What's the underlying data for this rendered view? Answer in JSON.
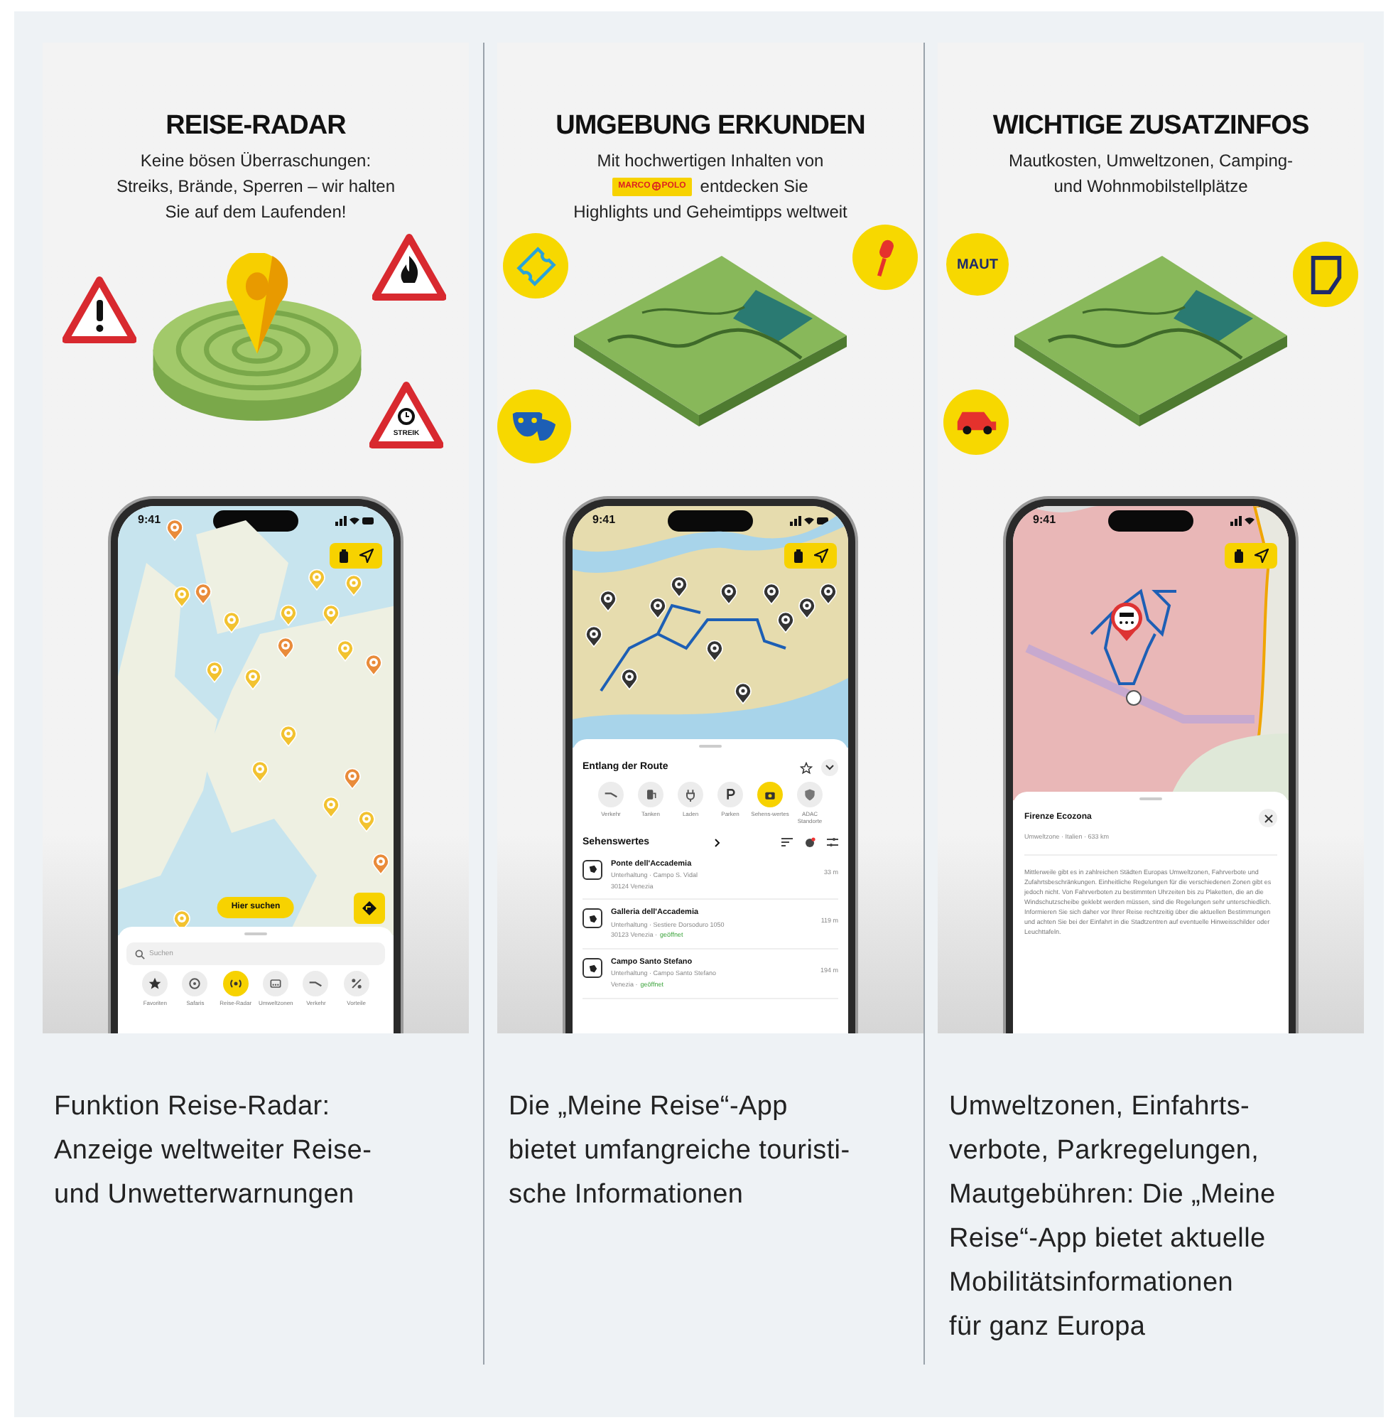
{
  "panels": [
    {
      "kind": "radar",
      "title": "REISE-RADAR",
      "subtitle": [
        "Keine bösen Überraschungen:",
        "Streiks, Brände, Sperren – wir halten",
        "Sie auf dem Laufenden!"
      ],
      "badges": [
        {
          "kind": "exclamation-sign"
        },
        {
          "kind": "fire-sign"
        },
        {
          "kind": "strike-sign",
          "label": "STREIK"
        }
      ],
      "phone": {
        "kind": "map-search",
        "time": "9:41",
        "search_button": "Hier suchen",
        "search": {
          "placeholder": "Suchen"
        },
        "categories": [
          {
            "label": "Favoriten",
            "selected": false
          },
          {
            "label": "Safaris",
            "selected": false
          },
          {
            "label": "Reise-Radar",
            "selected": true
          },
          {
            "label": "Umweltzonen",
            "selected": false
          },
          {
            "label": "Verkehr",
            "selected": false
          },
          {
            "label": "Vorteile",
            "selected": false
          }
        ]
      },
      "caption": [
        "Funktion Reise-Radar:",
        "Anzeige weltweiter Reise-",
        "und Unwetterwarnungen"
      ]
    },
    {
      "kind": "explore",
      "title": "UMGEBUNG ERKUNDEN",
      "subtitle": [
        "Mit hochwertigen Inhalten von"
      ],
      "logo": {
        "left": "MARCO",
        "right": "POLO"
      },
      "subtitle_after": [
        "entdecken Sie",
        "Highlights und Geheimtipps weltweit"
      ],
      "badges": [
        {
          "kind": "ticket"
        },
        {
          "kind": "microphone"
        },
        {
          "kind": "masks"
        }
      ],
      "phone": {
        "kind": "route-list",
        "time": "9:41",
        "header": "Entlang der Route",
        "categories": [
          {
            "label": "Verkehr",
            "selected": false
          },
          {
            "label": "Tanken",
            "selected": false
          },
          {
            "label": "Laden",
            "selected": false
          },
          {
            "label": "Parken",
            "selected": false
          },
          {
            "label": "Sehens-wertes",
            "selected": true
          },
          {
            "label": "ADAC Standorte",
            "selected": false
          }
        ],
        "section": "Sehenswertes",
        "items": [
          {
            "name": "Ponte dell'Accademia",
            "line1": "Unterhaltung · Campo S. Vidal",
            "line2": "30124 Venezia",
            "distance": "33 m"
          },
          {
            "name": "Galleria dell'Accademia",
            "line1": "Unterhaltung · Sestiere Dorsoduro 1050",
            "line2": "30123 Venezia ·",
            "status": "geöffnet",
            "distance": "119 m"
          },
          {
            "name": "Campo Santo Stefano",
            "line1": "Unterhaltung · Campo Santo Stefano",
            "line2": "Venezia ·",
            "status": "geöffnet",
            "distance": "194 m"
          }
        ]
      },
      "caption": [
        "Die „Meine Reise“-App",
        "bietet umfangreiche touristi-",
        "sche Informationen"
      ]
    },
    {
      "kind": "info",
      "title": "WICHTIGE ZUSATZINFOS",
      "subtitle": [
        "Mautkosten, Umweltzonen, Camping-",
        "und Wohnmobilstellplätze"
      ],
      "badges": [
        {
          "kind": "toll",
          "label": "MAUT"
        },
        {
          "kind": "vignette"
        },
        {
          "kind": "car"
        }
      ],
      "phone": {
        "kind": "zone-detail",
        "time": "9:41",
        "title": "Firenze Ecozona",
        "meta": "Umweltzone · Italien · 633 km",
        "text": "Mittlerweile gibt es in zahlreichen Städten Europas Umweltzonen, Fahrverbote und Zufahrtsbeschränkungen. Einheitliche Regelungen für die verschiedenen Zonen gibt es jedoch nicht. Von Fahrverboten zu bestimmten Uhrzeiten bis zu Plaketten, die an die Windschutzscheibe geklebt werden müssen, sind die Regelungen sehr unterschiedlich. Informieren Sie sich daher vor Ihrer Reise rechtzeitig über die aktuellen Bestimmungen und achten Sie bei der Einfahrt in die Stadtzentren auf eventuelle Hinweisschilder oder Leuchttafeln."
      },
      "caption": [
        "Umweltzonen, Einfahrts-",
        "verbote, Parkregelungen,",
        "Mautgebühren: Die „Meine",
        "Reise“-App bietet aktuelle",
        "Mobilitätsinformationen",
        "für ganz Europa"
      ]
    }
  ]
}
